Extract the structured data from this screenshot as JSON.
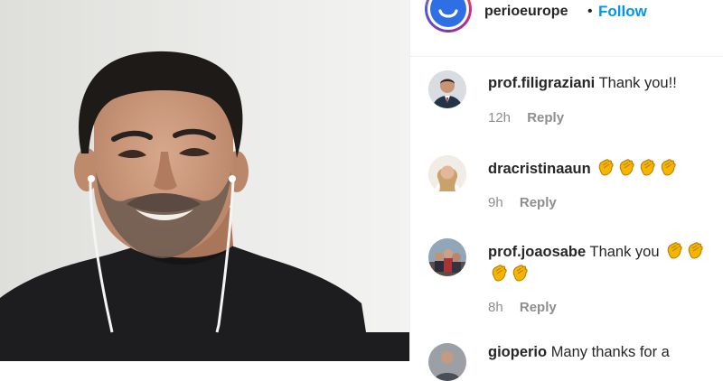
{
  "header": {
    "username": "perioeurope",
    "separator": "•",
    "follow_label": "Follow"
  },
  "comments": [
    {
      "username": "prof.filigraziani",
      "text": "Thank you!!",
      "claps": 0,
      "time": "12h",
      "reply_label": "Reply"
    },
    {
      "username": "dracristinaaun",
      "text": "",
      "claps": 4,
      "time": "9h",
      "reply_label": "Reply"
    },
    {
      "username": "prof.joaosabe",
      "text": "Thank you",
      "claps": 4,
      "time": "8h",
      "reply_label": "Reply"
    },
    {
      "username": "gioperio",
      "text": "Many thanks for a",
      "claps": 0,
      "time": "",
      "reply_label": ""
    }
  ],
  "icons": {
    "clap": "clapping-hands-icon"
  },
  "colors": {
    "follow": "#0095f6",
    "muted": "#8e8e8e",
    "text": "#262626",
    "clap": "#f4b400"
  }
}
